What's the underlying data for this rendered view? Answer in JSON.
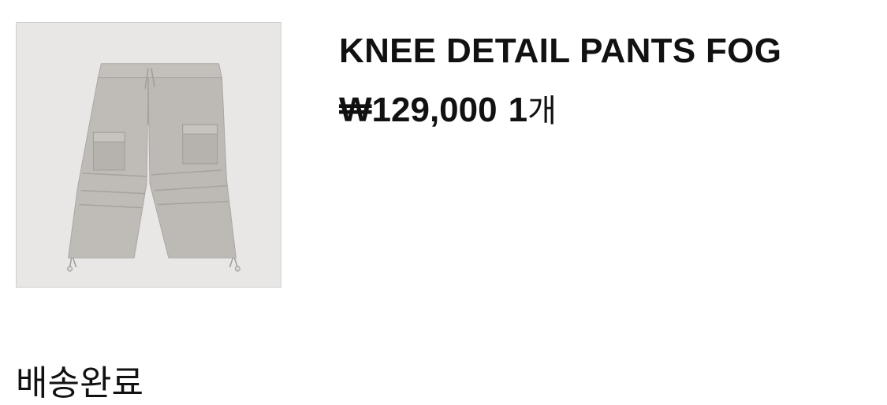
{
  "order_item": {
    "product_image": {
      "icon": "cargo-pants-image",
      "bg_color": "#e8e7e5",
      "garment_color": "#bdbab6"
    },
    "title": "KNEE DETAIL PANTS FOG",
    "price": "₩129,000",
    "quantity": "1",
    "quantity_unit": "개"
  },
  "status": {
    "label": "배송완료"
  }
}
